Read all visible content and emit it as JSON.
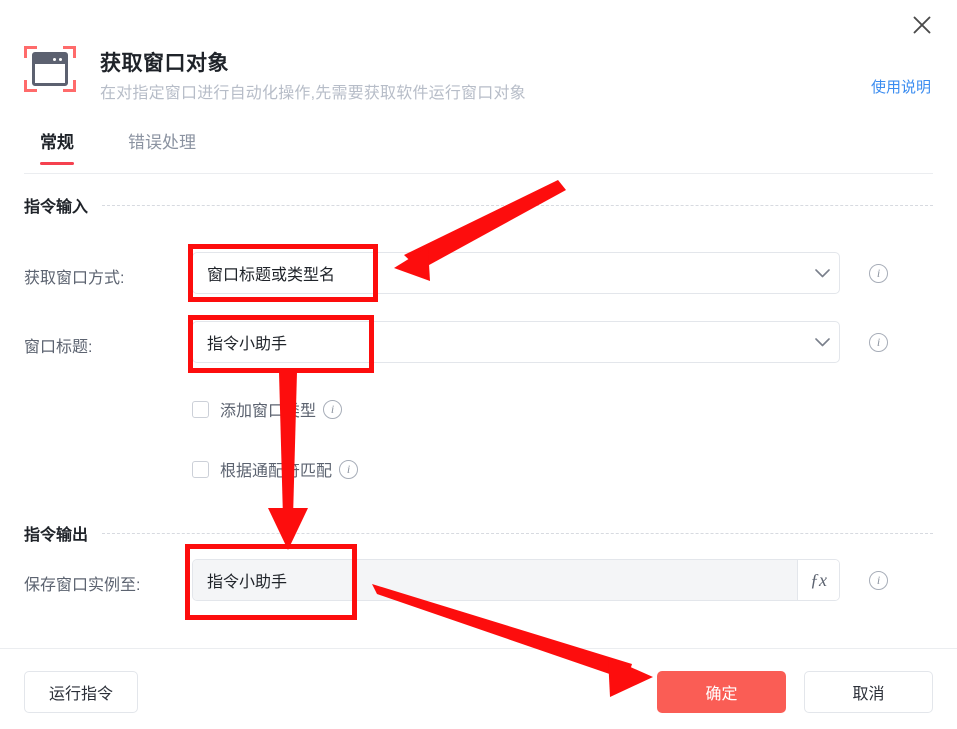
{
  "dialog": {
    "title": "获取窗口对象",
    "subtitle": "在对指定窗口进行自动化操作,先需要获取软件运行窗口对象",
    "help_link": "使用说明",
    "close_icon": "close-icon",
    "app_icon": "window-capture-icon"
  },
  "tabs": [
    {
      "label": "常规",
      "active": true
    },
    {
      "label": "错误处理",
      "active": false
    }
  ],
  "sections": {
    "input": {
      "title": "指令输入",
      "fields": [
        {
          "label": "获取窗口方式:",
          "value": "窗口标题或类型名",
          "icon": "chevron-down-icon",
          "info": "i"
        },
        {
          "label": "窗口标题:",
          "value": "指令小助手",
          "icon": "chevron-down-icon",
          "info": "i"
        }
      ],
      "checkboxes": [
        {
          "label": "添加窗口类型",
          "checked": false,
          "info": "i"
        },
        {
          "label": "根据通配符匹配",
          "checked": false,
          "info": "i"
        }
      ]
    },
    "output": {
      "title": "指令输出",
      "field": {
        "label": "保存窗口实例至:",
        "value": "指令小助手",
        "fx_label": "ƒx",
        "info": "i"
      }
    }
  },
  "footer": {
    "run_label": "运行指令",
    "ok_label": "确定",
    "cancel_label": "取消"
  },
  "colors": {
    "primary": "#fa5d55",
    "accent_tab": "#f5414f",
    "link": "#3a8cf0",
    "annotation": "#fd0d0d",
    "text": "#1f2329",
    "muted": "#5c6370",
    "placeholder": "#b7bdc8"
  }
}
